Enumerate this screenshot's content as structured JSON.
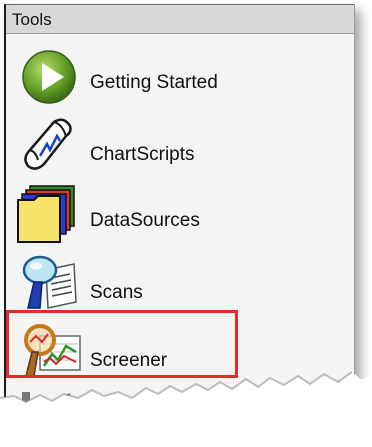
{
  "panel": {
    "title": "Tools",
    "items": [
      {
        "label": "Getting Started",
        "icon": "play-icon"
      },
      {
        "label": "ChartScripts",
        "icon": "script-scroll-icon"
      },
      {
        "label": "DataSources",
        "icon": "folder-stack-icon"
      },
      {
        "label": "Scans",
        "icon": "magnifier-document-icon"
      },
      {
        "label": "Screener",
        "icon": "screener-chart-icon",
        "highlighted": true
      }
    ]
  },
  "colors": {
    "highlight": "#e52a2a",
    "play_green": "#6aa329",
    "folder_yellow": "#f7e36a"
  }
}
